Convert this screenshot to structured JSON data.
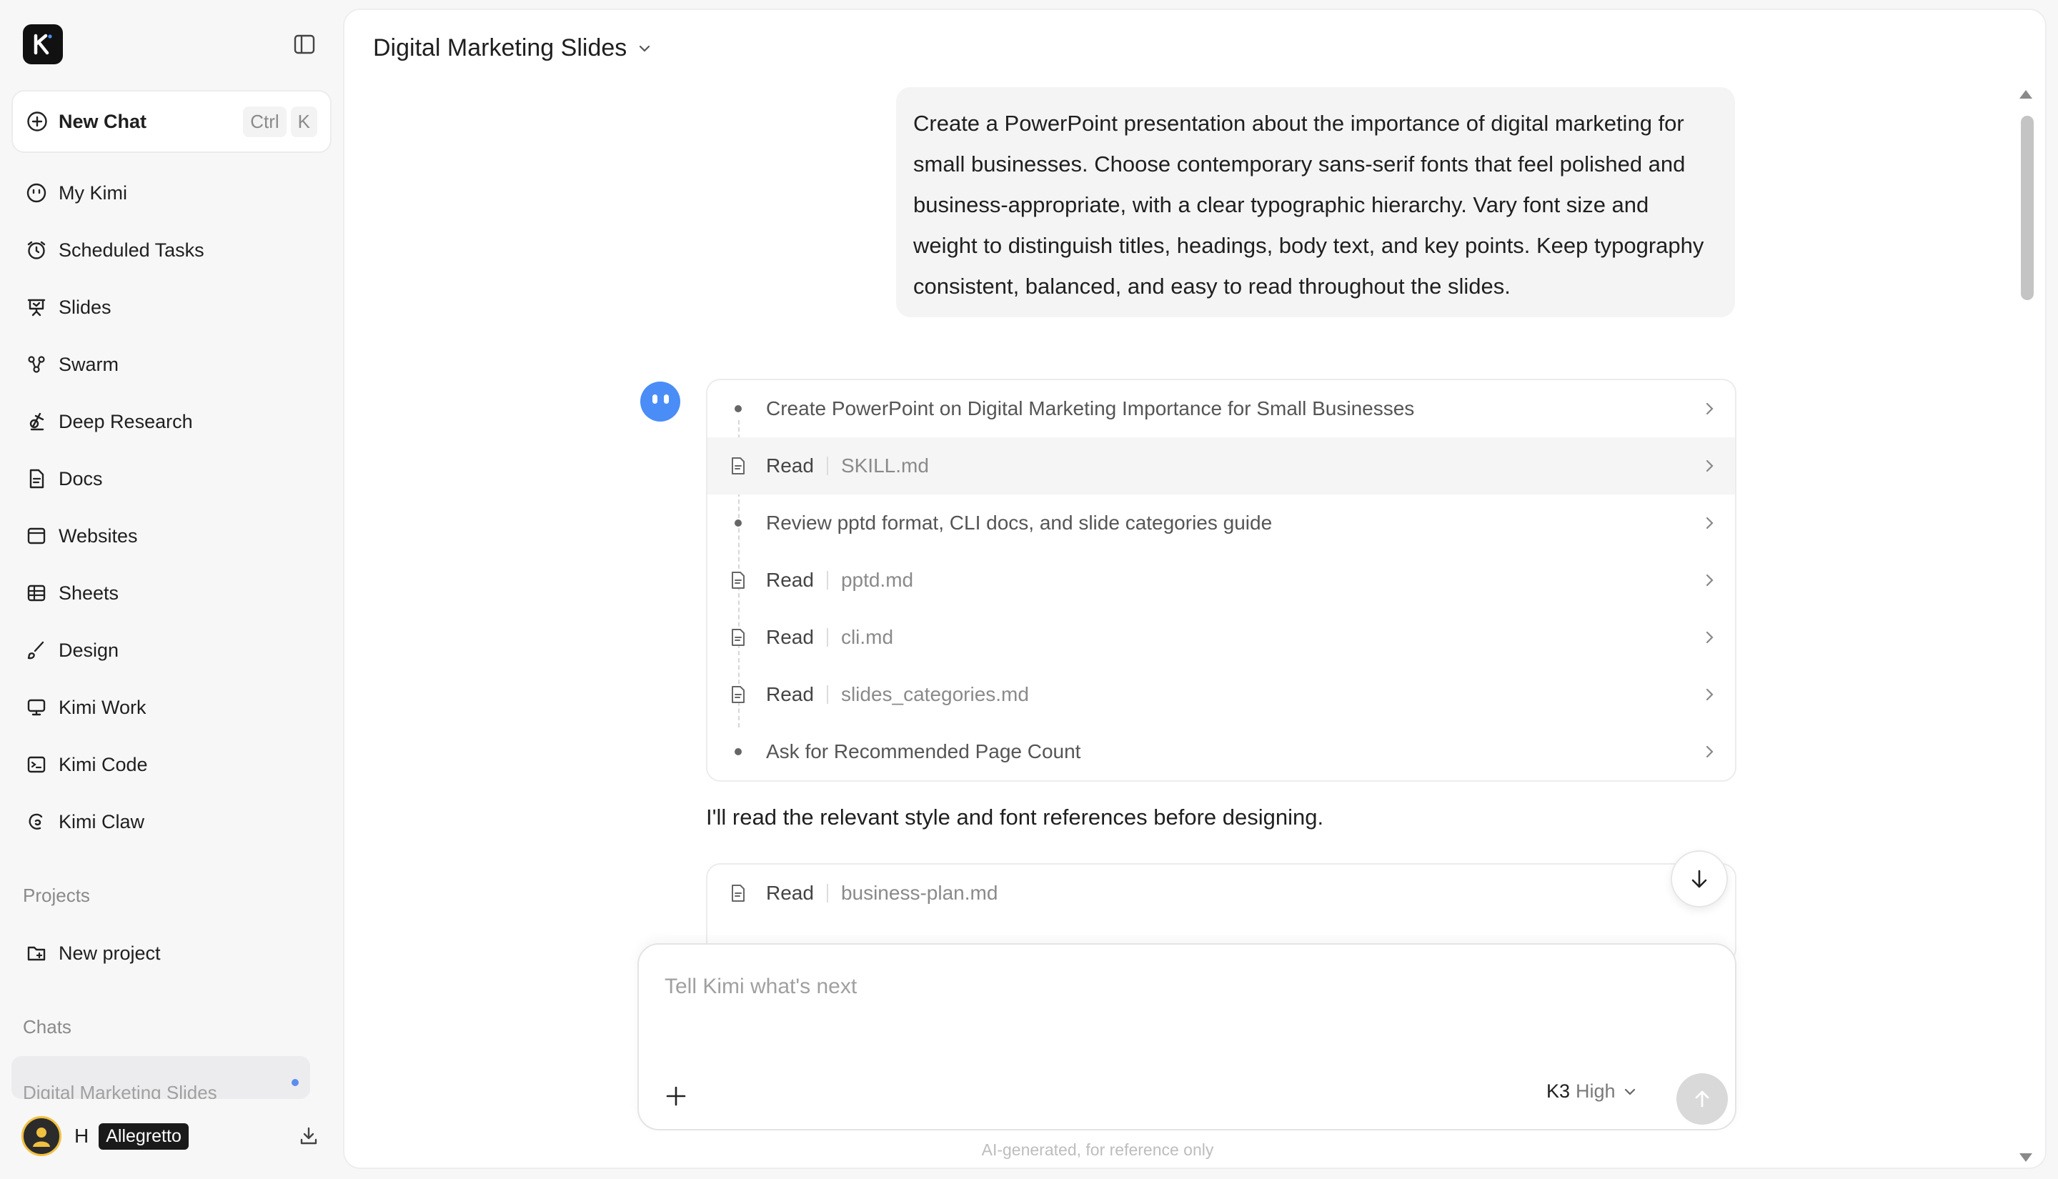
{
  "sidebar": {
    "new_chat": {
      "label": "New Chat",
      "shortcut": [
        "Ctrl",
        "K"
      ]
    },
    "items": [
      {
        "label": "My Kimi",
        "icon": "smiley-icon"
      },
      {
        "label": "Scheduled Tasks",
        "icon": "alarm-clock-icon"
      },
      {
        "label": "Slides",
        "icon": "presentation-icon"
      },
      {
        "label": "Swarm",
        "icon": "swarm-icon"
      },
      {
        "label": "Deep Research",
        "icon": "research-icon"
      },
      {
        "label": "Docs",
        "icon": "document-icon"
      },
      {
        "label": "Websites",
        "icon": "browser-window-icon"
      },
      {
        "label": "Sheets",
        "icon": "table-icon"
      },
      {
        "label": "Design",
        "icon": "brush-icon"
      },
      {
        "label": "Kimi Work",
        "icon": "monitor-icon"
      },
      {
        "label": "Kimi Code",
        "icon": "terminal-icon"
      },
      {
        "label": "Kimi Claw",
        "icon": "claw-icon"
      }
    ],
    "projects_title": "Projects",
    "new_project": "New project",
    "chats_title": "Chats",
    "chats": [
      {
        "label": "Digital Marketing Slides"
      }
    ],
    "user": {
      "initial": "H",
      "badge": "Allegretto"
    }
  },
  "main": {
    "title": "Digital Marketing Slides",
    "user_message": "Create a PowerPoint presentation about the importance of digital marketing for small businesses. Choose contemporary sans-serif fonts that feel polished and business-appropriate, with a clear typographic hierarchy. Vary font size and weight to distinguish titles, headings, body text, and key points. Keep typography consistent, balanced, and easy to read throughout the slides.",
    "steps": [
      {
        "type": "task",
        "text": "Create PowerPoint on Digital Marketing Importance for Small Businesses"
      },
      {
        "type": "read",
        "action": "Read",
        "file": "SKILL.md"
      },
      {
        "type": "task",
        "text": "Review pptd format, CLI docs, and slide categories guide"
      },
      {
        "type": "read",
        "action": "Read",
        "file": "pptd.md"
      },
      {
        "type": "read",
        "action": "Read",
        "file": "cli.md"
      },
      {
        "type": "read",
        "action": "Read",
        "file": "slides_categories.md"
      },
      {
        "type": "task",
        "text": "Ask for Recommended Page Count"
      }
    ],
    "reply": "I'll read the relevant style and font references before designing.",
    "steps2": [
      {
        "type": "read",
        "action": "Read",
        "file": "business-plan.md"
      }
    ],
    "composer": {
      "placeholder": "Tell Kimi what's next",
      "model": "K3",
      "effort": "High"
    },
    "footer_note": "AI-generated, for reference only"
  }
}
